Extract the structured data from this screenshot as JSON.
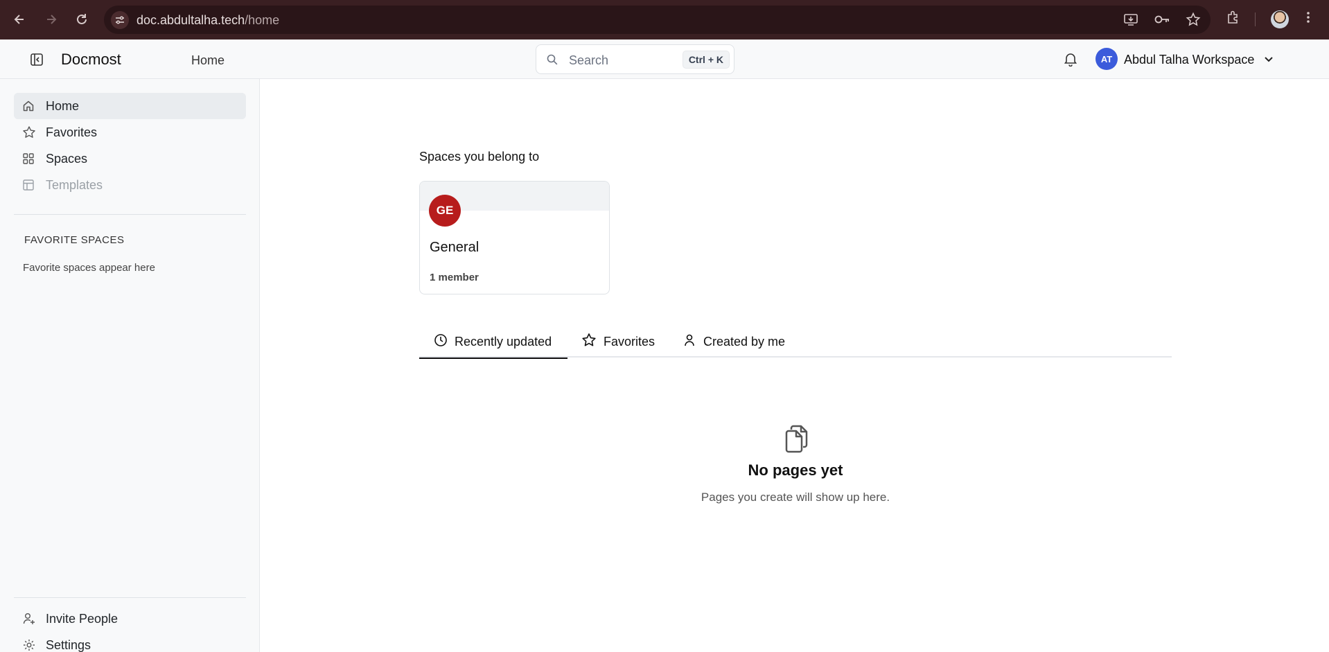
{
  "browser": {
    "url_domain": "doc.abdultalha.tech",
    "url_path": "/home"
  },
  "header": {
    "brand": "Docmost",
    "breadcrumb": "Home",
    "search_placeholder": "Search",
    "search_shortcut": "Ctrl + K",
    "workspace_initials": "AT",
    "workspace_name": "Abdul Talha Workspace"
  },
  "sidebar": {
    "items": [
      {
        "label": "Home",
        "icon": "home-icon",
        "active": true
      },
      {
        "label": "Favorites",
        "icon": "star-icon"
      },
      {
        "label": "Spaces",
        "icon": "grid-icon"
      },
      {
        "label": "Templates",
        "icon": "template-icon",
        "disabled": true
      }
    ],
    "favorite_spaces_title": "FAVORITE SPACES",
    "favorite_spaces_empty": "Favorite spaces appear here",
    "bottom": [
      {
        "label": "Invite People",
        "icon": "user-plus-icon"
      },
      {
        "label": "Settings",
        "icon": "gear-icon"
      }
    ]
  },
  "main": {
    "spaces_title": "Spaces you belong to",
    "spaces": [
      {
        "initials": "GE",
        "name": "General",
        "members": "1 member",
        "color": "#b71c1c"
      }
    ],
    "tabs": [
      {
        "label": "Recently updated",
        "icon": "clock-icon",
        "active": true
      },
      {
        "label": "Favorites",
        "icon": "star-icon"
      },
      {
        "label": "Created by me",
        "icon": "user-icon"
      }
    ],
    "empty_title": "No pages yet",
    "empty_subtitle": "Pages you create will show up here."
  },
  "colors": {
    "chrome_bg": "#3a1f22",
    "workspace_avatar": "#3b5bdb",
    "space_avatar": "#b71c1c"
  }
}
